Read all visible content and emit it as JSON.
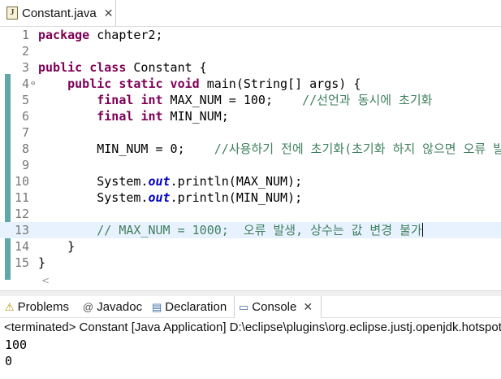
{
  "editor_tab": {
    "title": "Constant.java",
    "close": "✕",
    "icon_glyph": "J"
  },
  "code_lines": [
    {
      "n": "1"
    },
    {
      "n": "2"
    },
    {
      "n": "3"
    },
    {
      "n": "4",
      "fold": "⊖"
    },
    {
      "n": "5"
    },
    {
      "n": "6"
    },
    {
      "n": "7"
    },
    {
      "n": "8"
    },
    {
      "n": "9"
    },
    {
      "n": "10"
    },
    {
      "n": "11"
    },
    {
      "n": "12"
    },
    {
      "n": "13"
    },
    {
      "n": "14"
    },
    {
      "n": "15"
    }
  ],
  "code": {
    "l1_kw": "package",
    "l1_rest": " chapter2;",
    "l3_kw": "public class",
    "l3_rest": " Constant {",
    "l4_kw": "public static void",
    "l4_rest": " main(String[] args) {",
    "l5_kw1": "final",
    "l5_kw2": "int",
    "l5_rest": " MAX_NUM = 100;    ",
    "l5_comment": "//선언과 동시에 초기화",
    "l6_kw1": "final",
    "l6_kw2": "int",
    "l6_rest": " MIN_NUM;",
    "l8_rest": "MIN_NUM = 0;    ",
    "l8_comment": "//사용하기 전에 초기화(초기화 하지 않으면 오류 발생)",
    "l10_a": "System.",
    "l10_fld": "out",
    "l10_b": ".println(MAX_NUM);",
    "l11_a": "System.",
    "l11_fld": "out",
    "l11_b": ".println(MIN_NUM);",
    "l13_comment": "// MAX_NUM = 1000;  오류 발생, 상수는 값 변경 불가",
    "l14": "}",
    "l15": "}"
  },
  "hscroll": {
    "arrow": "<"
  },
  "view_tabs": [
    {
      "label": "Problems",
      "icon": "⚠"
    },
    {
      "label": "Javadoc",
      "icon": "@"
    },
    {
      "label": "Declaration",
      "icon": "▤"
    },
    {
      "label": "Console",
      "icon": "▭",
      "close": "✕"
    }
  ],
  "console": {
    "header": "<terminated> Constant [Java Application] D:\\eclipse\\plugins\\org.eclipse.justj.openjdk.hotspot",
    "output": [
      "100",
      "0"
    ]
  },
  "colors": {
    "keyword": "#7f0055",
    "comment": "#3f7f5f",
    "field": "#0000c0",
    "current_line": "#e8f2fe",
    "overview_bar": "#5fa8a8"
  }
}
